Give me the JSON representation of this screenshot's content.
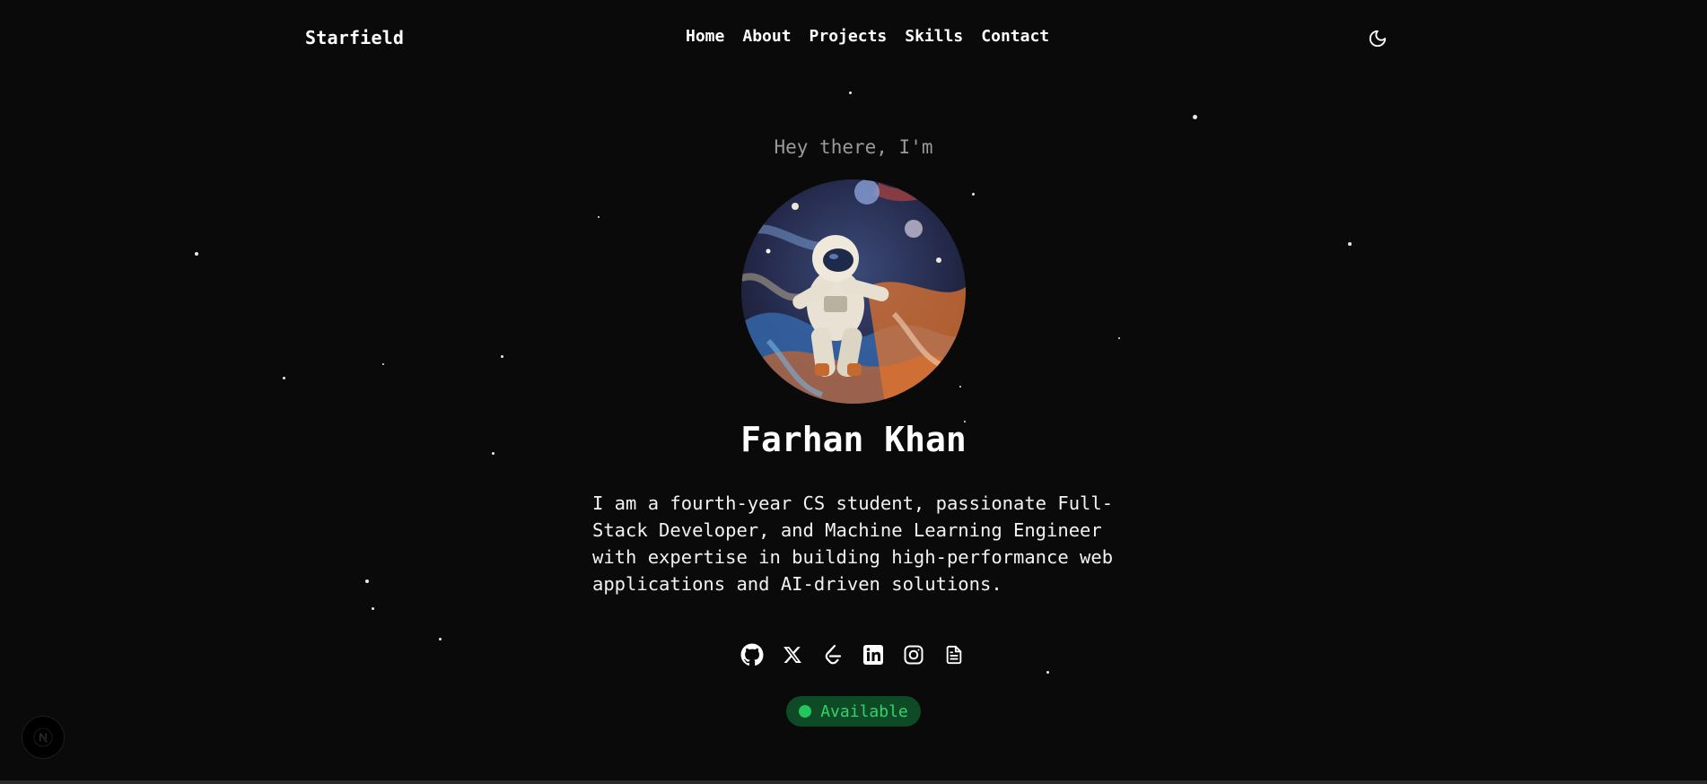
{
  "brand": {
    "logo": "Starfield"
  },
  "nav": {
    "items": [
      "Home",
      "About",
      "Projects",
      "Skills",
      "Contact"
    ]
  },
  "theme_toggle": {
    "icon": "moon-icon"
  },
  "hero": {
    "greeting": "Hey there, I'm",
    "avatar": {
      "icon": "astronaut-illustration"
    },
    "name": "Farhan Khan",
    "bio_lines": [
      "I am a fourth-year CS student, passionate Full-",
      "Stack Developer, and Machine Learning Engineer",
      "with expertise in building high-performance web",
      "applications and AI-driven solutions."
    ],
    "socials": [
      "github-icon",
      "x-icon",
      "leetcode-icon",
      "linkedin-icon",
      "instagram-icon",
      "resume-icon"
    ],
    "status": {
      "label": "Available",
      "color": "#22c55e"
    }
  },
  "colors": {
    "background": "#0a0a0a",
    "accent_green": "#22c55e",
    "muted_text": "#9a9a9a"
  },
  "dev_indicator": {
    "icon": "nextjs-icon"
  }
}
